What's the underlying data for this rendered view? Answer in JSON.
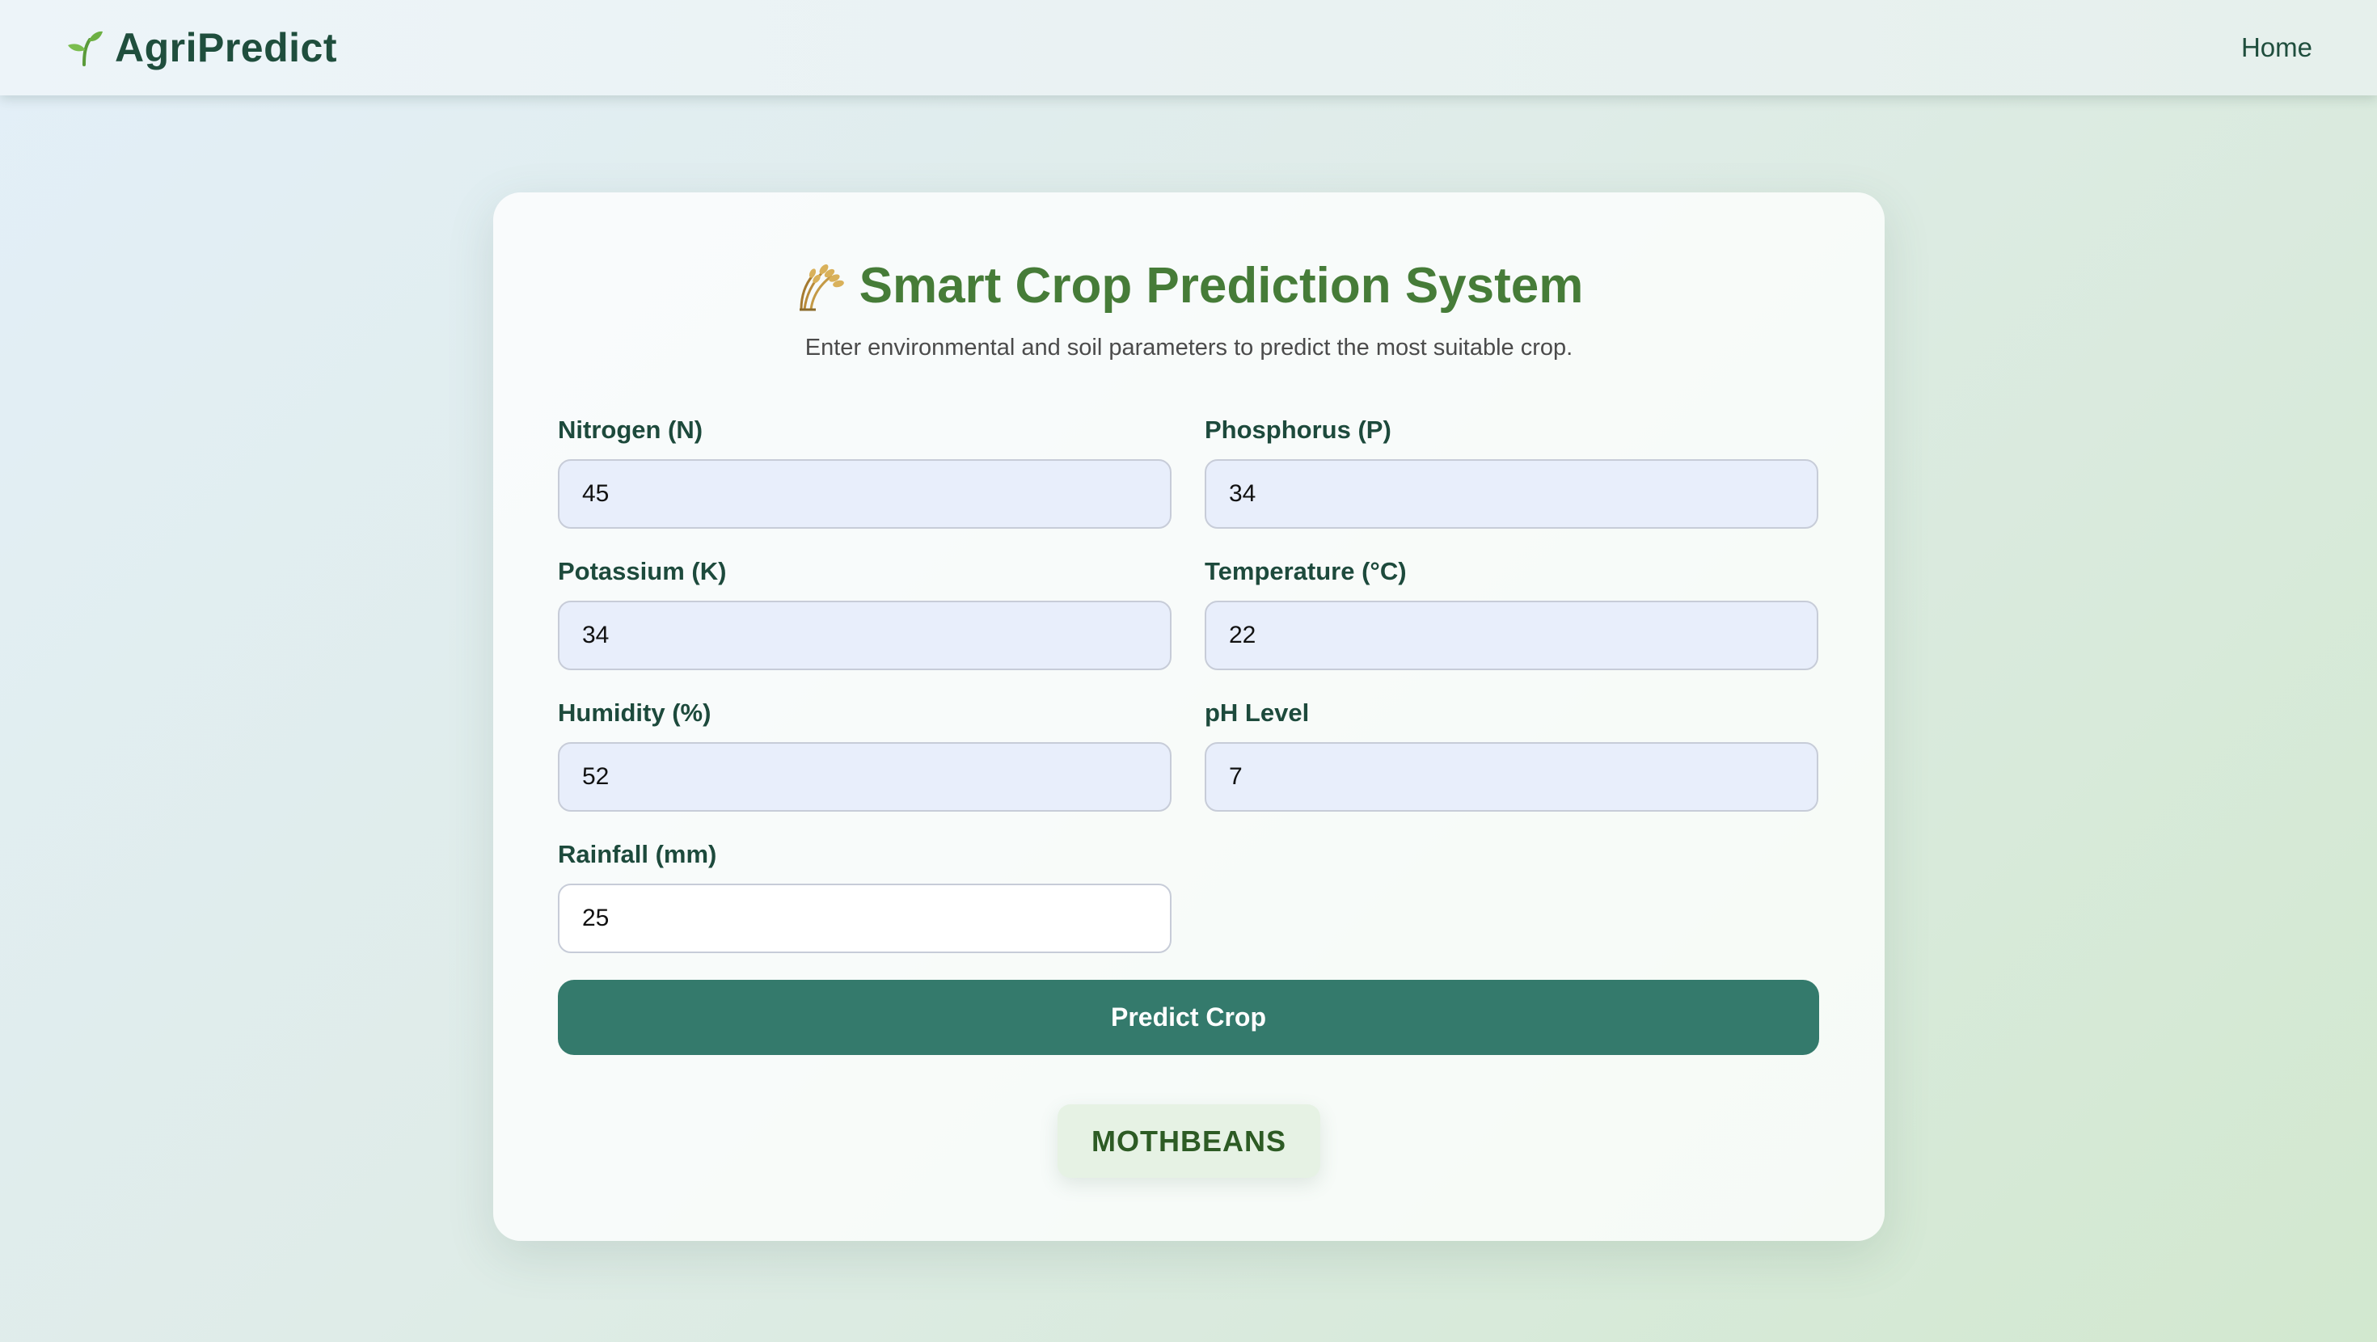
{
  "navbar": {
    "brand_icon": "seedling-icon",
    "brand_name": "AgriPredict",
    "home_link": "Home"
  },
  "card": {
    "title_icon": "rice-sheaf-icon",
    "title": "Smart Crop Prediction System",
    "subtitle": "Enter environmental and soil parameters to predict the most suitable crop."
  },
  "form": {
    "nitrogen": {
      "label": "Nitrogen (N)",
      "value": "45"
    },
    "phosphorus": {
      "label": "Phosphorus (P)",
      "value": "34"
    },
    "potassium": {
      "label": "Potassium (K)",
      "value": "34"
    },
    "temperature": {
      "label": "Temperature (°C)",
      "value": "22"
    },
    "humidity": {
      "label": "Humidity (%)",
      "value": "52"
    },
    "ph": {
      "label": "pH Level",
      "value": "7"
    },
    "rainfall": {
      "label": "Rainfall (mm)",
      "value": "25"
    },
    "submit_label": "Predict Crop"
  },
  "result": {
    "crop": "MOTHBEANS"
  },
  "colors": {
    "brand": "#1f4e3d",
    "title": "#467c38",
    "button": "#347a6c",
    "autofill_bg": "#e8eefb",
    "result_bg": "#e6f2e4",
    "result_text": "#2d5b24"
  }
}
